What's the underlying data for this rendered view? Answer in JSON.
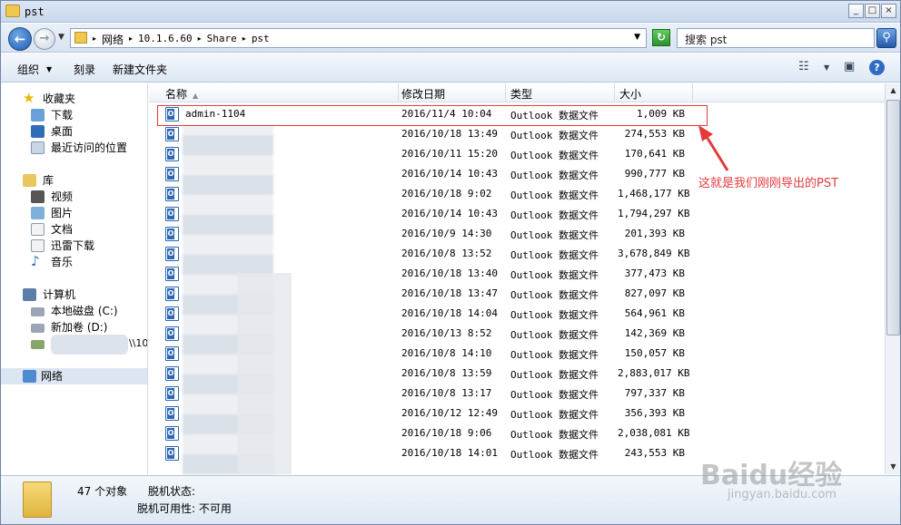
{
  "window": {
    "title": "pst"
  },
  "address": {
    "crumbs": [
      "网络",
      "10.1.6.60",
      "Share",
      "pst"
    ],
    "search_placeholder": "搜索 pst"
  },
  "toolbar": {
    "organize": "组织",
    "burn": "刻录",
    "new_folder": "新建文件夹"
  },
  "nav": {
    "favorites": "收藏夹",
    "fav_items": [
      "下载",
      "桌面",
      "最近访问的位置"
    ],
    "libraries": "库",
    "lib_items": [
      "视频",
      "图片",
      "文档",
      "迅雷下载",
      "音乐"
    ],
    "computer": "计算机",
    "drives": [
      "本地磁盘 (C:)",
      "新加卷 (D:)",
      "\\\\10"
    ],
    "network": "网络"
  },
  "columns": {
    "name": "名称",
    "date": "修改日期",
    "type": "类型",
    "size": "大小"
  },
  "files": [
    {
      "name": "admin-1104",
      "date": "2016/11/4 10:04",
      "type": "Outlook 数据文件",
      "size": "1,009 KB"
    },
    {
      "name": "",
      "date": "2016/10/18 13:49",
      "type": "Outlook 数据文件",
      "size": "274,553 KB"
    },
    {
      "name": "",
      "date": "2016/10/11 15:20",
      "type": "Outlook 数据文件",
      "size": "170,641 KB"
    },
    {
      "name": "",
      "date": "2016/10/14 10:43",
      "type": "Outlook 数据文件",
      "size": "990,777 KB"
    },
    {
      "name": "",
      "date": "2016/10/18 9:02",
      "type": "Outlook 数据文件",
      "size": "1,468,177 KB"
    },
    {
      "name": "",
      "date": "2016/10/14 10:43",
      "type": "Outlook 数据文件",
      "size": "1,794,297 KB"
    },
    {
      "name": "",
      "date": "2016/10/9 14:30",
      "type": "Outlook 数据文件",
      "size": "201,393 KB"
    },
    {
      "name": "",
      "date": "2016/10/8 13:52",
      "type": "Outlook 数据文件",
      "size": "3,678,849 KB"
    },
    {
      "name": "",
      "date": "2016/10/18 13:40",
      "type": "Outlook 数据文件",
      "size": "377,473 KB"
    },
    {
      "name": "",
      "date": "2016/10/18 13:47",
      "type": "Outlook 数据文件",
      "size": "827,097 KB"
    },
    {
      "name": "",
      "date": "2016/10/18 14:04",
      "type": "Outlook 数据文件",
      "size": "564,961 KB"
    },
    {
      "name": "",
      "date": "2016/10/13 8:52",
      "type": "Outlook 数据文件",
      "size": "142,369 KB"
    },
    {
      "name": "",
      "date": "2016/10/8 14:10",
      "type": "Outlook 数据文件",
      "size": "150,057 KB"
    },
    {
      "name": "",
      "date": "2016/10/8 13:59",
      "type": "Outlook 数据文件",
      "size": "2,883,017 KB"
    },
    {
      "name": "",
      "date": "2016/10/8 13:17",
      "type": "Outlook 数据文件",
      "size": "797,337 KB"
    },
    {
      "name": "",
      "date": "2016/10/12 12:49",
      "type": "Outlook 数据文件",
      "size": "356,393 KB"
    },
    {
      "name": "",
      "date": "2016/10/18 9:06",
      "type": "Outlook 数据文件",
      "size": "2,038,081 KB"
    },
    {
      "name": "",
      "date": "2016/10/18 14:01",
      "type": "Outlook 数据文件",
      "size": "243,553 KB"
    }
  ],
  "annotation": "这就是我们刚刚导出的PST",
  "details": {
    "count": "47 个对象",
    "offline_status_label": "脱机状态:",
    "offline_avail": "脱机可用性: 不可用"
  },
  "watermark": {
    "main": "Baidu经验",
    "sub": "jingyan.baidu.com"
  },
  "colors": {
    "accent": "#e23a3a",
    "nav_selected": "#dce6f2"
  }
}
